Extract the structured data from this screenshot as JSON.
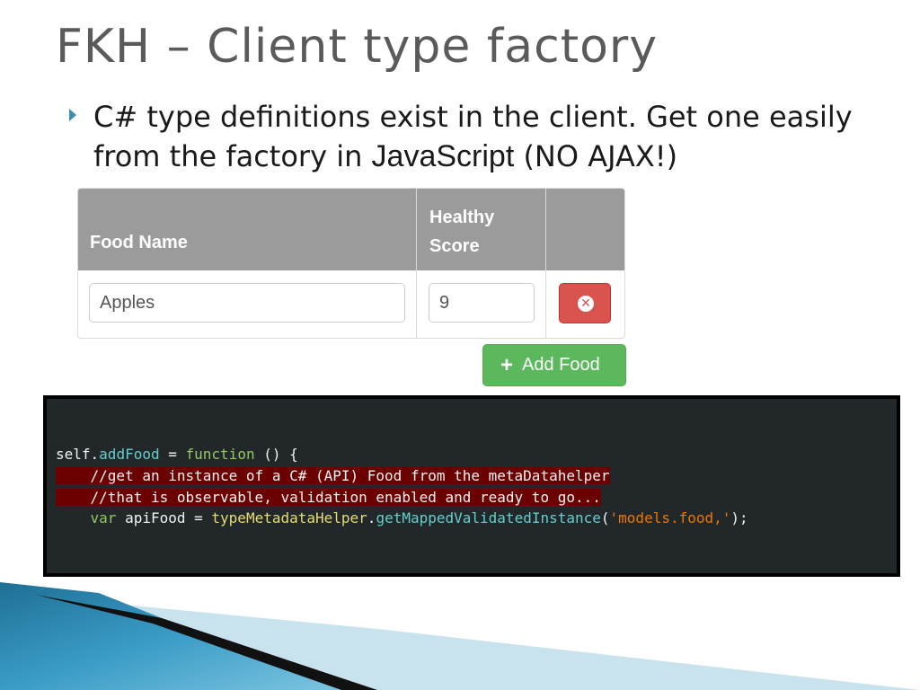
{
  "slide": {
    "title": "FKH – Client type factory",
    "bullet_part1": "C# type definitions exist in the client. Get one easily from the factory in ",
    "bullet_js": "JavaScript",
    "bullet_part2": " (NO AJAX!)"
  },
  "table": {
    "headers": {
      "food_name": "Food Name",
      "healthy": "Healthy",
      "score": "Score"
    },
    "row": {
      "food_name": "Apples",
      "healthy_score": "9"
    },
    "delete_icon": "close-circle-icon"
  },
  "add_button": {
    "icon": "plus-icon",
    "label": "Add Food"
  },
  "code": {
    "line1": {
      "a": "self",
      "b": ".",
      "c": "addFood",
      "d": " = ",
      "e": "function",
      "f": " () {"
    },
    "line2": "    //get an instance of a C# (API) Food from the metaDatahelper",
    "line3": "    //that is observable, validation enabled and ready to go...",
    "line4": {
      "indent": "    ",
      "kw": "var",
      "sp": " apiFood = ",
      "type": "typeMetadataHelper",
      "dot": ".",
      "call": "getMappedValidatedInstance",
      "open": "(",
      "str": "'models.food,'",
      "close": ");"
    }
  },
  "colors": {
    "title": "#5a5a5a",
    "table_header": "#9b9b9b",
    "danger": "#d9534f",
    "success": "#5cb85c",
    "code_bg": "#22282a",
    "code_highlight": "#6b0000",
    "accent_blue": "#3a8fb5"
  }
}
